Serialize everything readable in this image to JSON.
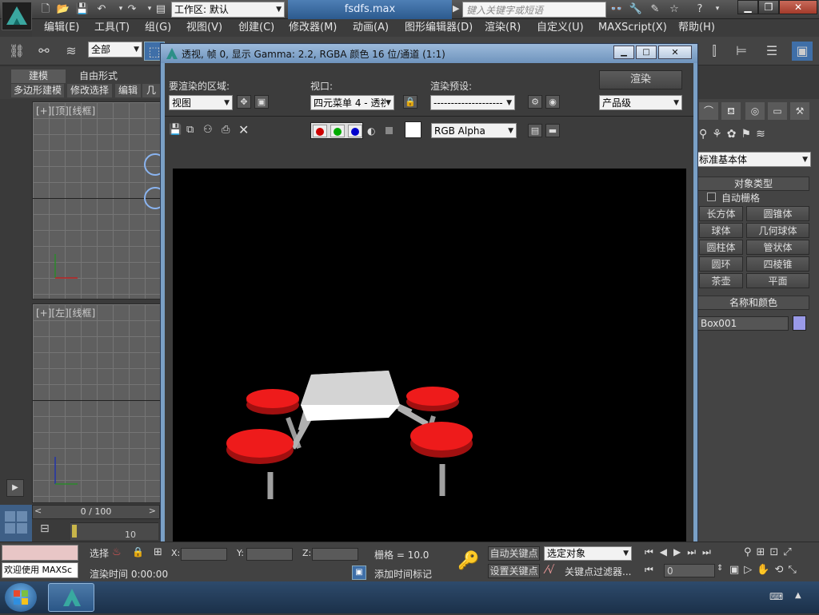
{
  "app": {
    "doc_title": "fsdfs.max",
    "workspace_label": "工作区: 默认",
    "search_placeholder": "键入关键字或短语"
  },
  "menu": [
    "编辑(E)",
    "工具(T)",
    "组(G)",
    "视图(V)",
    "创建(C)",
    "修改器(M)",
    "动画(A)",
    "图形编辑器(D)",
    "渲染(R)",
    "自定义(U)",
    "MAXScript(X)",
    "帮助(H)"
  ],
  "toolbar": {
    "selection_filter": "全部"
  },
  "ribbon": {
    "tabs": [
      "建模",
      "自由形式"
    ],
    "subtabs": [
      "多边形建模",
      "修改选择",
      "编辑",
      "几"
    ]
  },
  "viewports": {
    "top_left_label": "[+][顶][线框]",
    "bottom_left_label": "[+][左][线框]"
  },
  "timeline": {
    "frame_readout": "0 / 100",
    "tick_10": "10"
  },
  "render_window": {
    "title": "透视, 帧 0, 显示 Gamma: 2.2, RGBA 颜色 16 位/通道 (1:1)",
    "area_label": "要渲染的区域:",
    "area_value": "视图",
    "viewport_label": "视口:",
    "viewport_value": "四元菜单 4 - 透视",
    "preset_label": "渲染预设:",
    "preset_value": "--------------------",
    "render_button": "渲染",
    "quality_value": "产品级",
    "channel_value": "RGB Alpha"
  },
  "command_panel": {
    "category_value": "标准基本体",
    "object_type_header": "对象类型",
    "autogrid_label": "自动栅格",
    "buttons": [
      "长方体",
      "圆锥体",
      "球体",
      "几何球体",
      "圆柱体",
      "管状体",
      "圆环",
      "四棱锥",
      "茶壶",
      "平面"
    ],
    "name_color_header": "名称和颜色",
    "object_name": "Box001",
    "object_color": "#9a9ae8"
  },
  "status": {
    "maxscript_listener": "欢迎使用 MAXSc",
    "select_label": "选择",
    "x_label": "X:",
    "y_label": "Y:",
    "z_label": "Z:",
    "grid_readout": "栅格 = 10.0",
    "auto_key": "自动关键点",
    "selected_object": "选定对象",
    "set_key": "设置关键点",
    "key_filter": "关键点过滤器...",
    "render_time": "渲染时间  0:00:00",
    "add_time_tag": "添加时间标记",
    "frame_value": "0"
  },
  "colors": {
    "accent_blue": "#2c5a8e",
    "swatch_red": "#cc0000",
    "swatch_green": "#00aa00",
    "swatch_blue": "#0000cc",
    "seat_red": "#ee1b1b"
  }
}
